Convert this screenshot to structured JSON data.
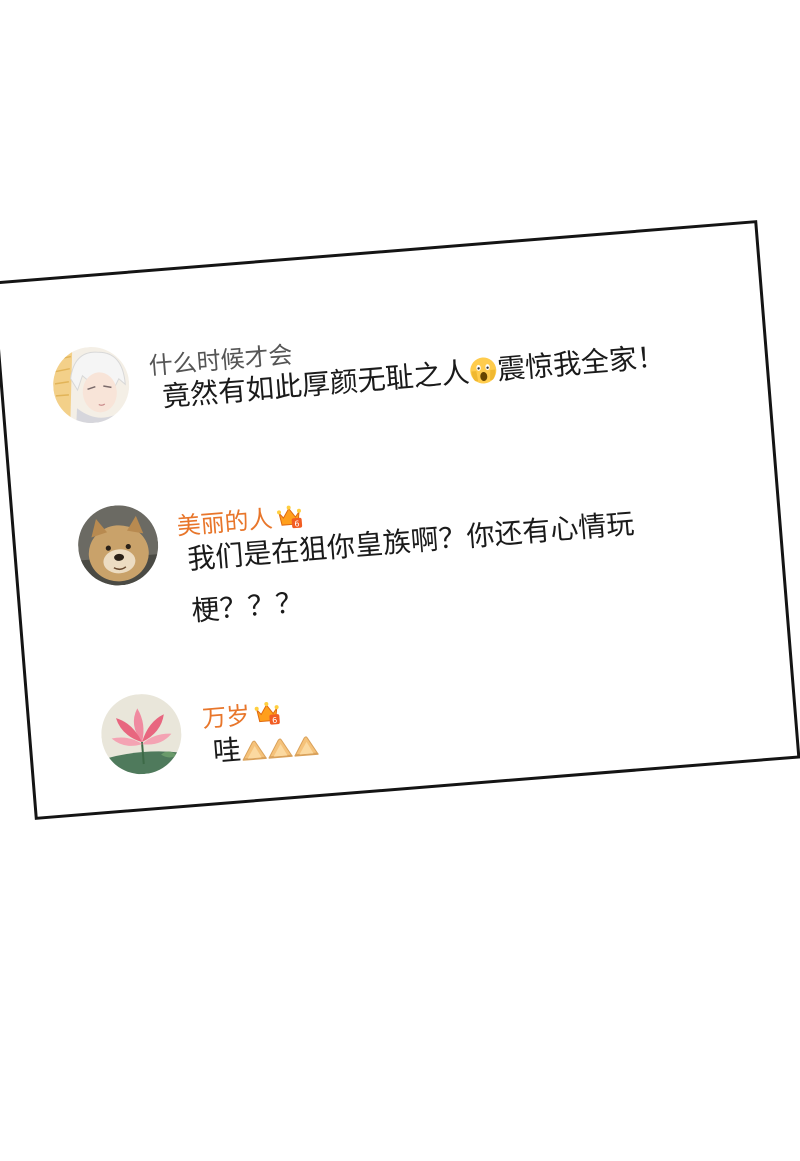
{
  "comments": [
    {
      "username": "什么时候才会",
      "username_style": "plain",
      "avatar_icon": "anime-character-avatar",
      "text_before_emoji": "竟然有如此厚颜无耻之人",
      "emoji": "scream-face-emoji",
      "text_after_emoji": "震惊我全家！"
    },
    {
      "username": "美丽的人",
      "username_style": "vip",
      "badge": "crown-vip-badge",
      "avatar_icon": "dog-photo-avatar",
      "text_line1": "我们是在狙你皇族啊？你还有心情玩",
      "text_line2": "梗？？？"
    },
    {
      "username": "万岁",
      "username_style": "vip",
      "badge": "crown-vip-badge",
      "avatar_icon": "lotus-painting-avatar",
      "text": "哇",
      "emoji": "clapping-hands-emoji",
      "emoji_count": 3
    }
  ],
  "colors": {
    "vip_name": "#e8762b",
    "plain_name": "#555555",
    "text": "#1a1a1a",
    "border": "#141414"
  }
}
